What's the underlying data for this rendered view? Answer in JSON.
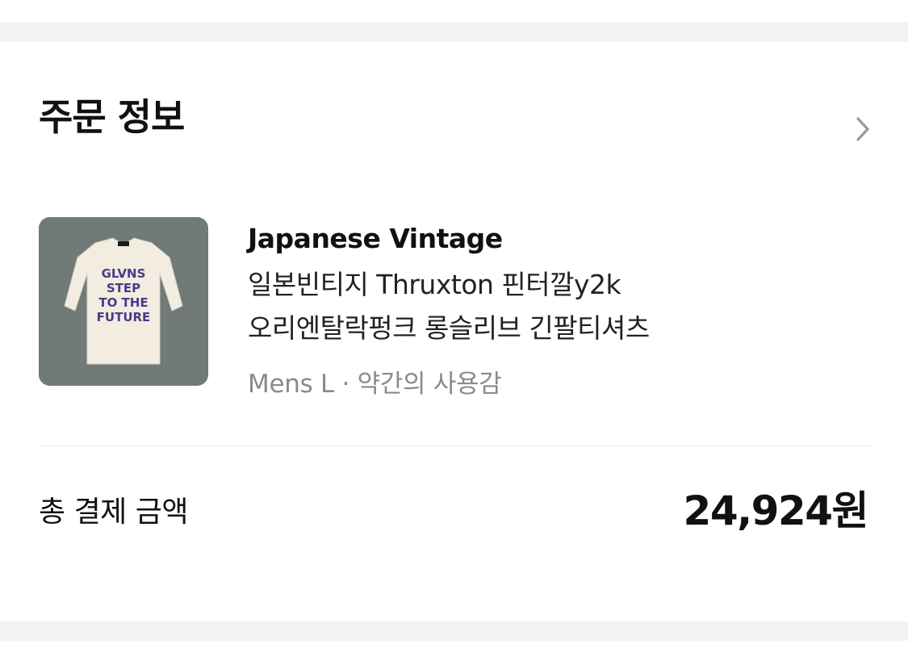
{
  "section": {
    "title": "주문 정보"
  },
  "product": {
    "brand": "Japanese Vintage",
    "title_line1": "일본빈티지 Thruxton 핀터깔y2k",
    "title_line2": "오리엔탈락펑크 롱슬리브 긴팔티셔츠",
    "meta": "Mens L · 약간의 사용감",
    "image_alt": "long sleeve shirt photo",
    "print_text": [
      "GLVNS",
      "STEP",
      "TO THE",
      "FUTURE"
    ]
  },
  "total": {
    "label": "총 결제 금액",
    "amount": "24,924원"
  },
  "colors": {
    "background": "#ffffff",
    "separator_band": "#f2f2f2",
    "text_primary": "#111111",
    "text_secondary": "#8a8a8a",
    "chevron": "#9a9a9a"
  }
}
